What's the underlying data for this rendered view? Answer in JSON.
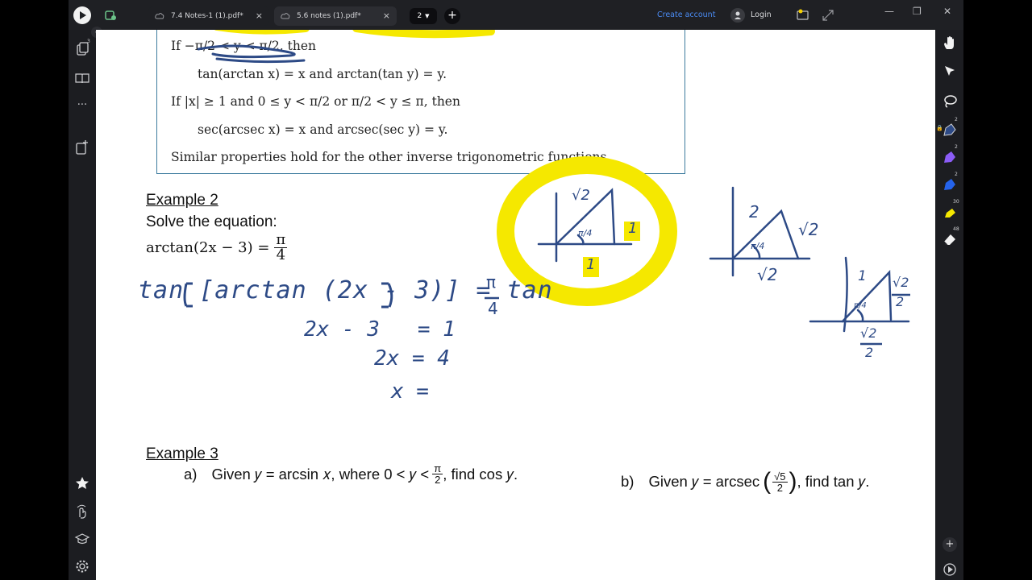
{
  "titlebar": {
    "tabs": [
      {
        "label": "7.4 Notes-1 (1).pdf*",
        "close": "×"
      },
      {
        "label": "5.6 notes (1).pdf*",
        "close": "×"
      }
    ],
    "tab_count": "2",
    "new_tab": "+",
    "create_account": "Create account",
    "login": "Login",
    "window_controls": {
      "minimize": "—",
      "maximize": "❐",
      "close": "✕"
    }
  },
  "left_toolbar": {
    "badge": "3",
    "items": [
      "pages-icon",
      "book-icon",
      "more-icon",
      "add-page-icon",
      "star-icon",
      "gesture-icon",
      "learn-icon",
      "settings-icon"
    ],
    "more_label": "···"
  },
  "right_toolbar": {
    "items": [
      "hand-icon",
      "pointer-icon",
      "lasso-icon",
      "pen-navy-icon",
      "pen-purple-icon",
      "pen-blue-icon",
      "highlighter-yellow-icon",
      "eraser-icon"
    ],
    "counts": [
      "2",
      "2",
      "2",
      "30",
      "48"
    ],
    "colors": {
      "navy": "#2d4a86",
      "purple": "#8b5cf6",
      "blue": "#2563eb",
      "yellow": "#f5e800"
    },
    "add": "+"
  },
  "theorem": {
    "line1": "If −π/2 < y < π/2, then",
    "line2": "tan(arctan x) = x    and    arctan(tan y) = y.",
    "line3": "If |x| ≥ 1 and 0 ≤ y < π/2 or π/2 < y ≤ π, then",
    "line4": "sec(arcsec x) = x    and    arcsec(sec y) = y.",
    "line5": "Similar properties hold for the other inverse trigonometric functions."
  },
  "example2": {
    "title": "Example 2",
    "prompt": "Solve the equation:",
    "lhs": "arctan(2x − 3) =",
    "rhs_num": "π",
    "rhs_den": "4"
  },
  "handwriting": {
    "line1": "tan [arctan (2x - 3)] = tan",
    "line1_num": "π",
    "line1_den": "4",
    "line2": "2x - 3   = 1",
    "line3": "2x = 4",
    "line4": "x =",
    "tri1_hyp": "√2",
    "tri1_side": "1",
    "tri1_base": "1",
    "tri1_angle": "π/4",
    "tri2_hyp": "2",
    "tri2_side": "√2",
    "tri2_base": "√2",
    "tri2_angle": "π/4",
    "tri3_hyp": "1",
    "tri3_side_num": "√2",
    "tri3_side_den": "2",
    "tri3_base_num": "√2",
    "tri3_base_den": "2",
    "tri3_angle": "π/4"
  },
  "example3": {
    "title": "Example 3",
    "a_label": "a)",
    "a_text1": "Given 𝑦 = arcsin 𝑥, where 0 < 𝑦 <",
    "a_num": "π",
    "a_den": "2",
    "a_text2": ", find cos 𝑦.",
    "b_label": "b)",
    "b_text1": "Given 𝑦 = arcsec",
    "b_num": "√5",
    "b_den": "2",
    "b_text2": ", find tan 𝑦."
  }
}
